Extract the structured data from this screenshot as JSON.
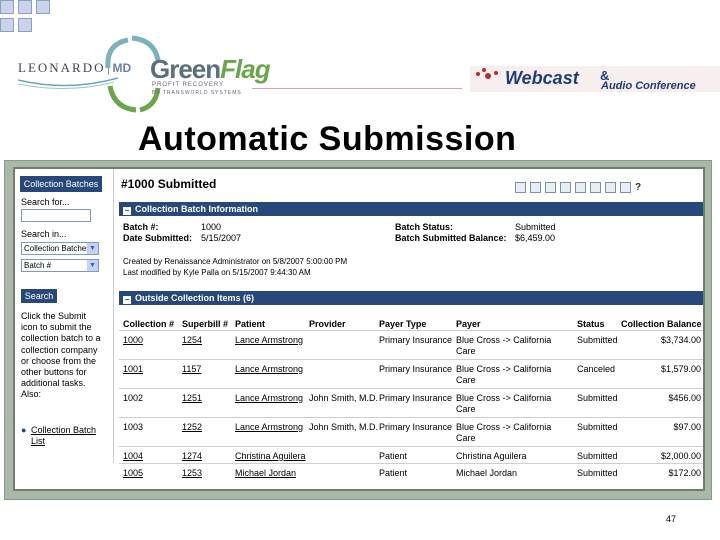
{
  "header": {
    "leonardo_logo": "LEONARDO",
    "leonardo_md": "MD",
    "greenflag_green": "Green",
    "greenflag_flag": "Flag",
    "greenflag_sub1": "PROFIT RECOVERY",
    "greenflag_sub2": "BY TRANSWORLD SYSTEMS",
    "webcast": "Webcast",
    "amp": "&",
    "audio": "Audio Conference"
  },
  "slide_title": "Automatic Submission",
  "sidebar": {
    "heading": "Collection Batches",
    "search_for_label": "Search for...",
    "search_for_value": "",
    "search_in_label": "Search in...",
    "search_in_select": "Collection Batches",
    "field_select": "Batch #",
    "search_button": "Search",
    "help_text": "Click the Submit icon to submit the collection batch to a collection company or choose from the other buttons for additional tasks. Also:",
    "link_label": "Collection Batch List"
  },
  "main": {
    "title": "#1000 Submitted",
    "toolbar_icons": [
      "edit-icon",
      "copy-icon",
      "list-icon",
      "print-icon",
      "print-preview-icon",
      "attachment-icon",
      "submit-icon",
      "delete-icon"
    ],
    "help_label": "?",
    "section1": {
      "title": "Collection Batch Information",
      "batch_num_label": "Batch #:",
      "batch_num_value": "1000",
      "date_label": "Date Submitted:",
      "date_value": "5/15/2007",
      "status_label": "Batch Status:",
      "status_value": "Submitted",
      "balance_label": "Batch Submitted Balance:",
      "balance_value": "$6,459.00",
      "created_by": "Created by Renaissance Administrator on 5/8/2007 5:00:00 PM",
      "modified_by": "Last modified by Kyle Palla on 5/15/2007 9:44:30 AM"
    },
    "section2": {
      "title": "Outside Collection Items (6)",
      "columns": [
        "Collection #",
        "Superbill #",
        "Patient",
        "Provider",
        "Payer Type",
        "Payer",
        "Status",
        "Collection Balance"
      ],
      "rows": [
        {
          "collection": "1000",
          "superbill": "1254",
          "patient": "Lance Armstrong",
          "provider": "",
          "payer_type": "Primary Insurance",
          "payer": "Blue Cross -> California Care",
          "status": "Submitted",
          "balance": "$3,734.00"
        },
        {
          "collection": "1001",
          "superbill": "1157",
          "patient": "Lance Armstrong",
          "provider": "",
          "payer_type": "Primary Insurance",
          "payer": "Blue Cross -> California Care",
          "status": "Canceled",
          "balance": "$1,579.00"
        },
        {
          "collection": "1002",
          "superbill": "1251",
          "patient": "Lance Armstrong",
          "provider": "John Smith, M.D.",
          "payer_type": "Primary Insurance",
          "payer": "Blue Cross -> California Care",
          "status": "Submitted",
          "balance": "$456.00"
        },
        {
          "collection": "1003",
          "superbill": "1252",
          "patient": "Lance Armstrong",
          "provider": "John Smith, M.D.",
          "payer_type": "Primary Insurance",
          "payer": "Blue Cross -> California Care",
          "status": "Submitted",
          "balance": "$97.00"
        },
        {
          "collection": "1004",
          "superbill": "1274",
          "patient": "Christina Aguilera",
          "provider": "",
          "payer_type": "Patient",
          "payer": "Christina Aguilera",
          "status": "Submitted",
          "balance": "$2,000.00"
        },
        {
          "collection": "1005",
          "superbill": "1253",
          "patient": "Michael Jordan",
          "provider": "",
          "payer_type": "Patient",
          "payer": "Michael Jordan",
          "status": "Submitted",
          "balance": "$172.00"
        }
      ]
    }
  },
  "page_number": "47",
  "colors": {
    "nav_blue": "#27487a",
    "frame_green": "#a9b9a9",
    "webcast_blue": "#1f3d7a"
  }
}
